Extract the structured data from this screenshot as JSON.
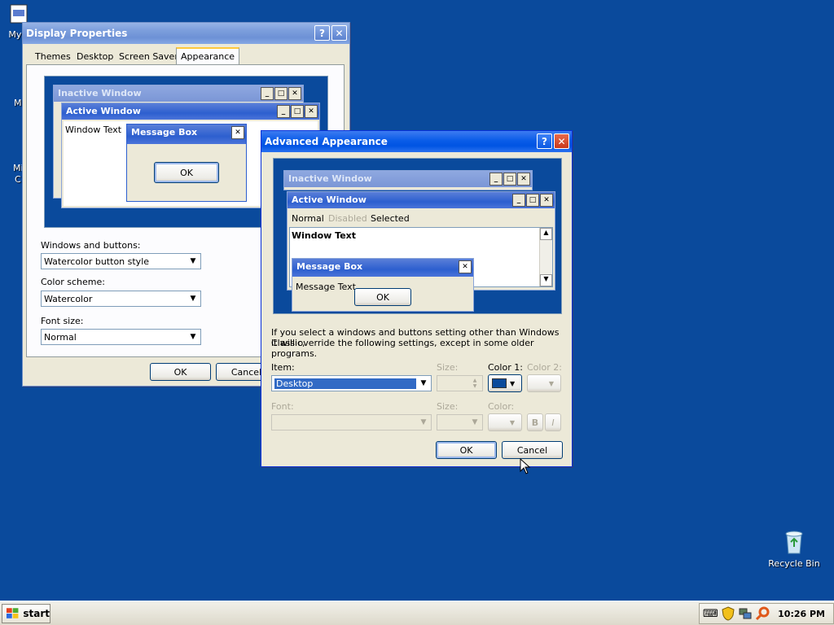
{
  "desktop": {
    "icons": {
      "my_computer_partial": "My C",
      "m1_partial": "M",
      "m2_partial": "Mi",
      "m2_partial2": "C",
      "recycle_bin": "Recycle Bin"
    }
  },
  "display_properties": {
    "title": "Display Properties",
    "tabs": [
      "Themes",
      "Desktop",
      "Screen Saver",
      "Appearance"
    ],
    "active_tab": "Appearance",
    "preview": {
      "inactive_title": "Inactive Window",
      "active_title": "Active Window",
      "window_text": "Window Text",
      "message_box_title": "Message Box",
      "ok": "OK"
    },
    "windows_buttons_label": "Windows and buttons:",
    "windows_buttons_value": "Watercolor button style",
    "color_scheme_label": "Color scheme:",
    "color_scheme_value": "Watercolor",
    "font_size_label": "Font size:",
    "font_size_value": "Normal",
    "ok_label": "OK",
    "cancel_label": "Cancel"
  },
  "advanced": {
    "title": "Advanced Appearance",
    "preview": {
      "inactive_title": "Inactive Window",
      "active_title": "Active Window",
      "menu_normal": "Normal",
      "menu_disabled": "Disabled",
      "menu_selected": "Selected",
      "window_text": "Window Text",
      "message_box_title": "Message Box",
      "message_text": "Message Text",
      "ok": "OK"
    },
    "info_line1": "If you select a windows and buttons setting other than Windows Classic,",
    "info_line2": "it will override the following settings, except in some older programs.",
    "item_label": "Item:",
    "item_value": "Desktop",
    "size_label": "Size:",
    "color1_label": "Color 1:",
    "color2_label": "Color 2:",
    "font_label": "Font:",
    "size2_label": "Size:",
    "color_label": "Color:",
    "bold_label": "B",
    "italic_label": "I",
    "ok_label": "OK",
    "cancel_label": "Cancel"
  },
  "taskbar": {
    "start_label": "start",
    "clock": "10:26 PM"
  },
  "colors": {
    "desktop": "#0a4a9c",
    "color1_swatch": "#0a4a9c"
  }
}
